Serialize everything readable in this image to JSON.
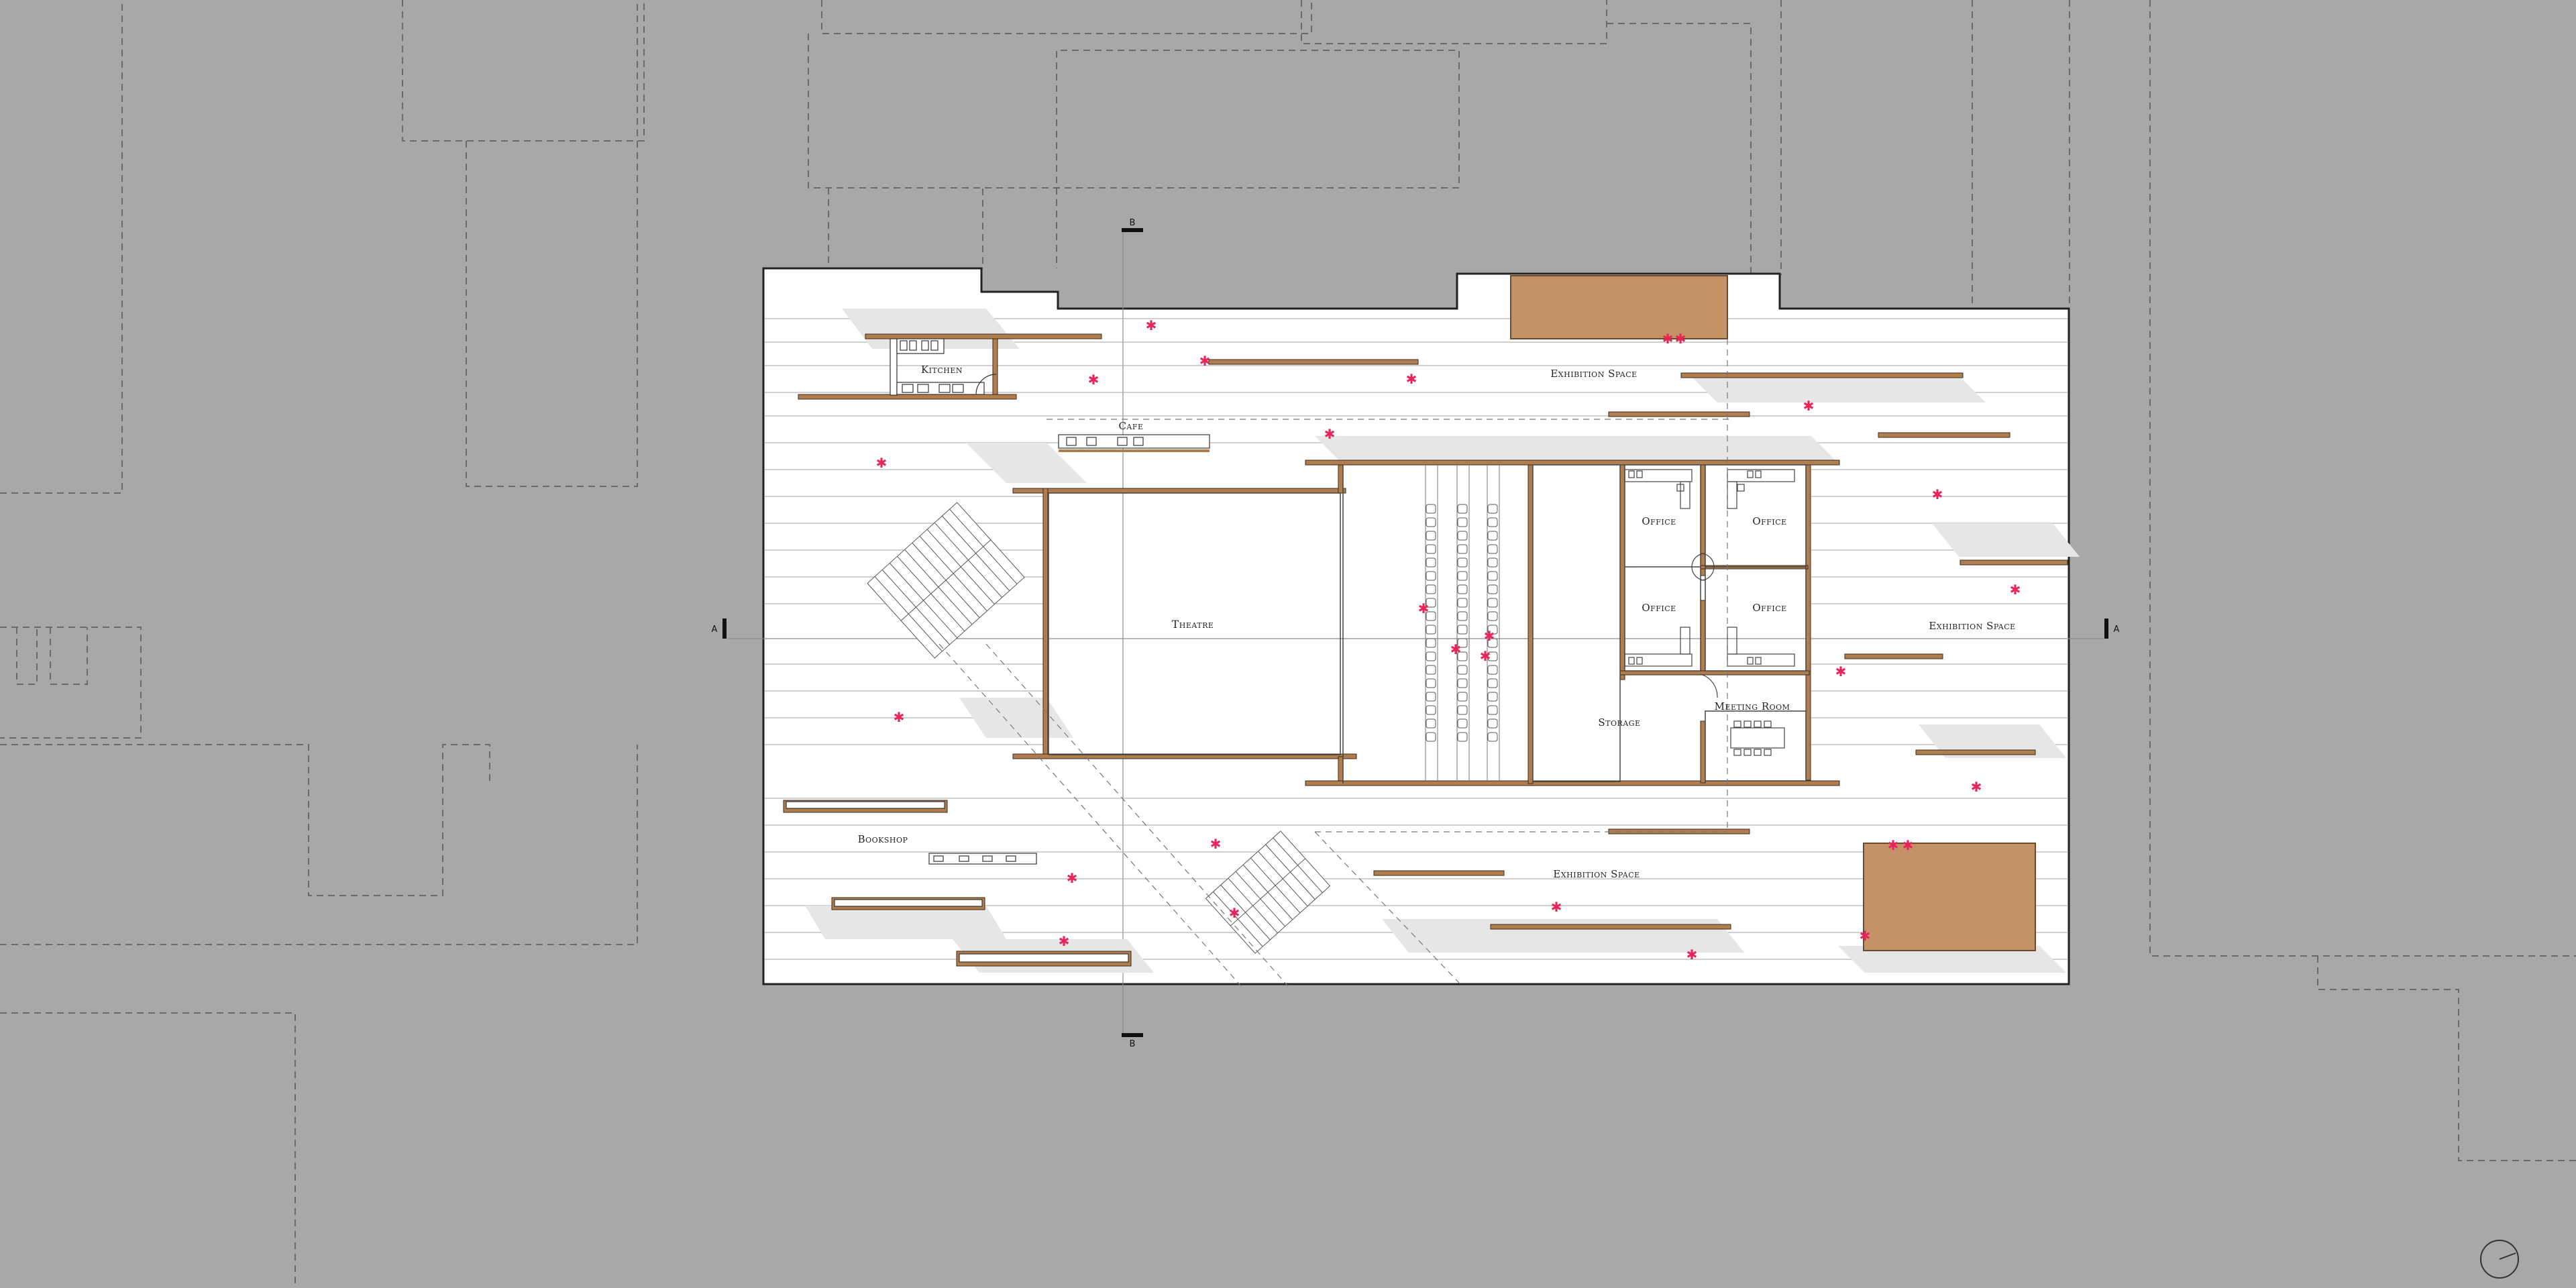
{
  "drawing": {
    "type": "architectural-floor-plan",
    "colors": {
      "background": "#a7a9a9",
      "floor": "#ffffff",
      "wall": "#b07d4f",
      "exhibit": "#c49267",
      "figure": "#e8245a",
      "context_line": "#6e6e6e"
    }
  },
  "rooms": {
    "kitchen": "Kitchen",
    "cafe": "Cafe",
    "theatre": "Theatre",
    "bookshop": "Bookshop",
    "exhibition_top": "Exhibition Space",
    "exhibition_right": "Exhibition Space",
    "exhibition_bottom": "Exhibition Space",
    "office_1": "Office",
    "office_2": "Office",
    "office_3": "Office",
    "office_4": "Office",
    "storage": "Storage",
    "meeting_room": "Meeting Room"
  },
  "section_markers": {
    "a_left": "A",
    "a_right": "A",
    "b_top": "B",
    "b_bottom": "B"
  },
  "north_arrow": {
    "icon": "north-arrow-icon"
  }
}
